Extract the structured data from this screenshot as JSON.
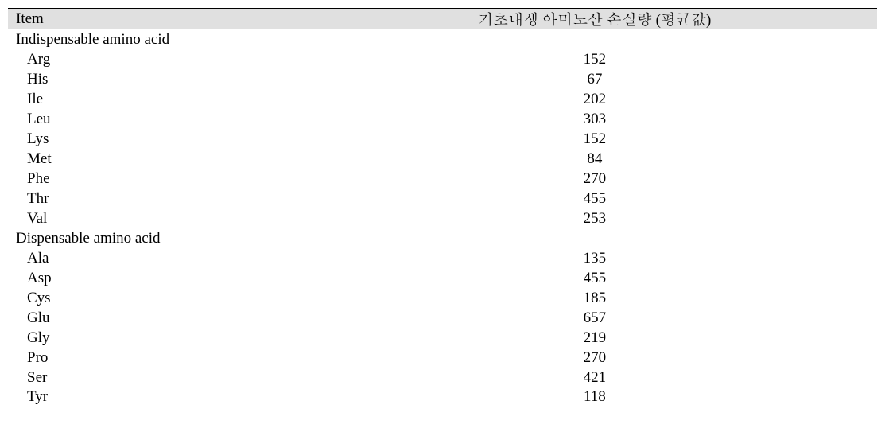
{
  "table": {
    "headers": {
      "item": "Item",
      "value": "기초내생 아미노산 손실량 (평균값)"
    },
    "sections": [
      {
        "title": "Indispensable amino acid",
        "rows": [
          {
            "label": "Arg",
            "value": "152"
          },
          {
            "label": "His",
            "value": "67"
          },
          {
            "label": "Ile",
            "value": "202"
          },
          {
            "label": "Leu",
            "value": "303"
          },
          {
            "label": "Lys",
            "value": "152"
          },
          {
            "label": "Met",
            "value": "84"
          },
          {
            "label": "Phe",
            "value": "270"
          },
          {
            "label": "Thr",
            "value": "455"
          },
          {
            "label": "Val",
            "value": "253"
          }
        ]
      },
      {
        "title": "Dispensable amino acid",
        "rows": [
          {
            "label": "Ala",
            "value": "135"
          },
          {
            "label": "Asp",
            "value": "455"
          },
          {
            "label": "Cys",
            "value": "185"
          },
          {
            "label": "Glu",
            "value": "657"
          },
          {
            "label": "Gly",
            "value": "219"
          },
          {
            "label": "Pro",
            "value": "270"
          },
          {
            "label": "Ser",
            "value": "421"
          },
          {
            "label": "Tyr",
            "value": "118"
          }
        ]
      }
    ]
  }
}
